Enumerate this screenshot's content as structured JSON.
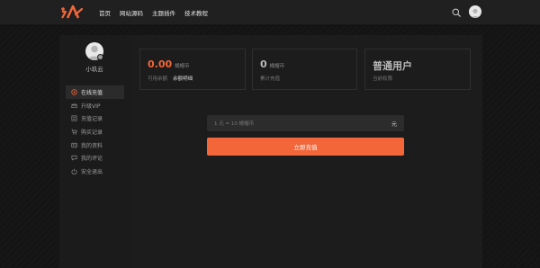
{
  "brand": {
    "accent": "#f2663a"
  },
  "header": {
    "nav": [
      "首页",
      "网站源码",
      "主题插件",
      "技术教程"
    ]
  },
  "sidebar": {
    "username": "小玖云",
    "items": [
      {
        "label": "在线充值",
        "icon": "coin-icon",
        "active": true
      },
      {
        "label": "升级VIP",
        "icon": "crown-icon",
        "active": false
      },
      {
        "label": "充值记录",
        "icon": "receipt-icon",
        "active": false
      },
      {
        "label": "购买记录",
        "icon": "cart-icon",
        "active": false
      },
      {
        "label": "我的资料",
        "icon": "profile-card-icon",
        "active": false
      },
      {
        "label": "我的评论",
        "icon": "comment-icon",
        "active": false
      },
      {
        "label": "安全退出",
        "icon": "logout-icon",
        "active": false
      }
    ]
  },
  "stats": {
    "balance": {
      "value": "0.00",
      "unit": "橘帽币",
      "label": "可用余额",
      "link": "余额明细",
      "color": "#f2663a"
    },
    "spent": {
      "value": "0",
      "unit": "橘帽币",
      "label": "累计充值",
      "color": "#b8b8b8"
    },
    "level": {
      "value": "普通用户",
      "label": "当前权限",
      "color": "#b8b8b8"
    }
  },
  "recharge": {
    "placeholder": "1 元 = 10 橘帽币",
    "suffix": "元",
    "button_label": "立即充值"
  }
}
